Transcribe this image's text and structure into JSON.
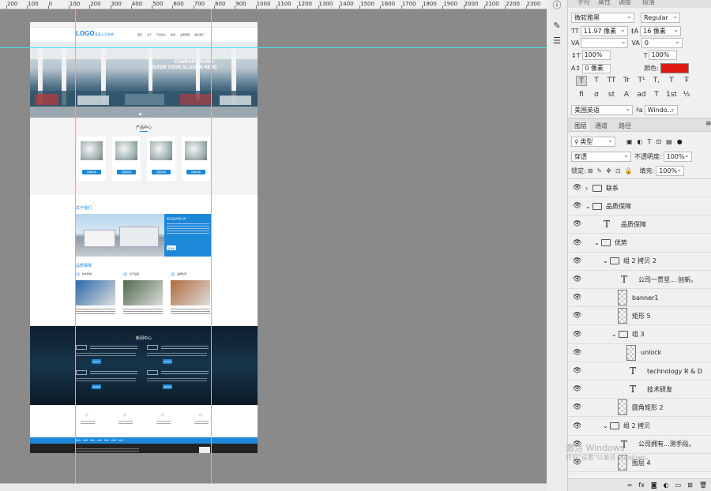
{
  "ruler": {
    "labels": [
      "200",
      "100",
      "0",
      "100",
      "200",
      "300",
      "400",
      "500",
      "600",
      "700",
      "800",
      "900",
      "1000",
      "1100",
      "1200",
      "1300",
      "1400",
      "1500",
      "1600",
      "1700",
      "1800",
      "1900",
      "2000",
      "2100",
      "2200",
      "2300",
      "2400"
    ]
  },
  "character": {
    "tabs": [
      "字符",
      "属性",
      "调整",
      "段落"
    ],
    "font_family": "微软雅黑",
    "font_style": "Regular",
    "font_size": "11.97 像素",
    "leading": "16 像素",
    "kerning": "",
    "tracking": "0",
    "vscale": "100%",
    "hscale": "100%",
    "baseline": "0 像素",
    "color_label": "颜色:",
    "color": "#e01a12",
    "style_buttons": [
      "T",
      "T",
      "TT",
      "Tr",
      "T¹",
      "T,",
      "T",
      "Ŧ"
    ],
    "ot_buttons": [
      "fi",
      "σ",
      "st",
      "A",
      "ad",
      "T",
      "1st",
      "½"
    ],
    "language": "美国英语",
    "antialias": "Windo..."
  },
  "layers_panel": {
    "tabs": [
      "图层",
      "通道",
      "路径"
    ],
    "filter": "类型",
    "blend_mode": "穿透",
    "opacity_label": "不透明度:",
    "opacity": "100%",
    "lock_label": "锁定:",
    "fill_label": "填充:",
    "fill": "100%",
    "layers": [
      {
        "name": "联系",
        "type": "folder",
        "indent": 0,
        "expanded": false
      },
      {
        "name": "品质保障",
        "type": "folder",
        "indent": 0,
        "expanded": true
      },
      {
        "name": "品质保障",
        "type": "text",
        "indent": 1
      },
      {
        "name": "优势",
        "type": "folder",
        "indent": 1,
        "expanded": true
      },
      {
        "name": "组 2 拷贝 2",
        "type": "folder",
        "indent": 2,
        "expanded": true
      },
      {
        "name": "公司一贯坚... 创新。",
        "type": "text",
        "indent": 3
      },
      {
        "name": "banner1",
        "type": "image",
        "indent": 3
      },
      {
        "name": "矩形 5",
        "type": "image",
        "indent": 3
      },
      {
        "name": "组 3",
        "type": "folder",
        "indent": 3,
        "expanded": true
      },
      {
        "name": "unlock",
        "type": "image",
        "indent": 4
      },
      {
        "name": "technology R & D",
        "type": "text",
        "indent": 4
      },
      {
        "name": "技术研发",
        "type": "text",
        "indent": 4
      },
      {
        "name": "圆角矩形 2",
        "type": "image",
        "indent": 3
      },
      {
        "name": "组 2 拷贝",
        "type": "folder",
        "indent": 2,
        "expanded": true
      },
      {
        "name": "公司拥有...测手段。",
        "type": "text",
        "indent": 3
      },
      {
        "name": "图层 4",
        "type": "image",
        "indent": 3
      }
    ]
  },
  "watermark": {
    "line1": "激活 Windows",
    "line2": "转到\"设置\"以激活 Windows。"
  },
  "site": {
    "logo": "LOGO",
    "logo_sub": "某某公司名称",
    "nav": [
      "首页",
      "关于",
      "产品中心",
      "新闻",
      "品质保障",
      "联系我们"
    ],
    "banner_line1": "COMPANY NAME",
    "banner_line2": "ENTER YOUR SLOGAN HERE",
    "products_title": "产品中心",
    "product_btn": "查看详情",
    "about_title": "关于我们",
    "about_company": "浙江某某有限公司",
    "more_btn": "查看更多",
    "quality_title": "品质保障",
    "quality_items": [
      "技术研发",
      "生产设备",
      "品质检测"
    ],
    "news_title": "新闻中心",
    "news_btn": "MORE",
    "footer_bar": "联系我们"
  }
}
